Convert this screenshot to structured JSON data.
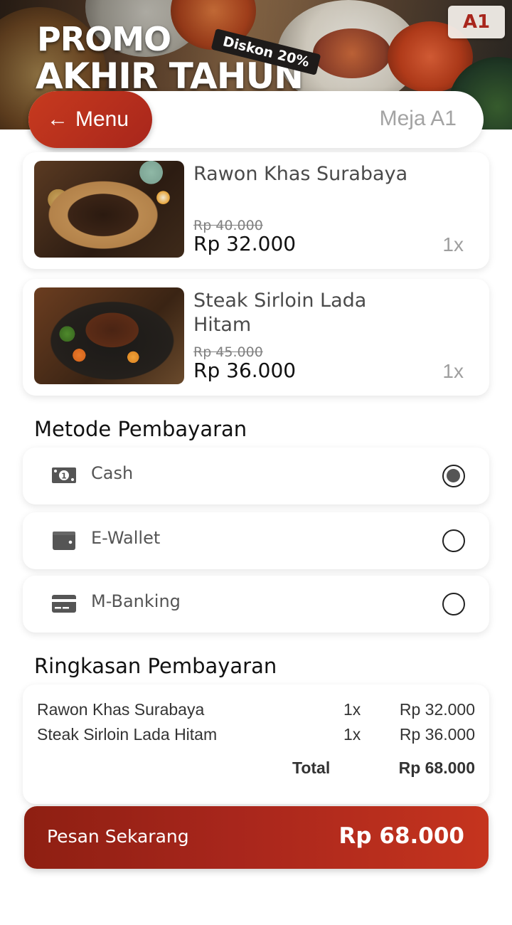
{
  "banner": {
    "promo_line1": "PROMO",
    "promo_line2": "AKHIR TAHUN",
    "discount_tag": "Diskon 20%",
    "table_badge": "A1"
  },
  "header": {
    "back_label": "Menu",
    "table_label": "Meja A1"
  },
  "cart": {
    "items": [
      {
        "name": "Rawon Khas Surabaya",
        "old_price": "Rp 40.000",
        "price": "Rp 32.000",
        "qty": "1x",
        "image": "rawon-dish-photo"
      },
      {
        "name": "Steak Sirloin Lada Hitam",
        "old_price": "Rp 45.000",
        "price": "Rp 36.000",
        "qty": "1x",
        "image": "steak-sizzling-plate-photo"
      }
    ]
  },
  "payment": {
    "title": "Metode Pembayaran",
    "methods": [
      {
        "label": "Cash",
        "icon": "cash-icon",
        "selected": true
      },
      {
        "label": "E-Wallet",
        "icon": "wallet-icon",
        "selected": false
      },
      {
        "label": "M-Banking",
        "icon": "credit-card-icon",
        "selected": false
      }
    ]
  },
  "summary": {
    "title": "Ringkasan Pembayaran",
    "rows": [
      {
        "name": "Rawon Khas Surabaya",
        "qty": "1x",
        "price": "Rp 32.000"
      },
      {
        "name": "Steak Sirloin Lada Hitam",
        "qty": "1x",
        "price": "Rp 36.000"
      }
    ],
    "total_label": "Total",
    "total_value": "Rp 68.000"
  },
  "order": {
    "label": "Pesan Sekarang",
    "total": "Rp 68.000"
  },
  "colors": {
    "accent": "#a8261c",
    "accent_light": "#c5341e",
    "muted_text": "#a3a3a3"
  }
}
